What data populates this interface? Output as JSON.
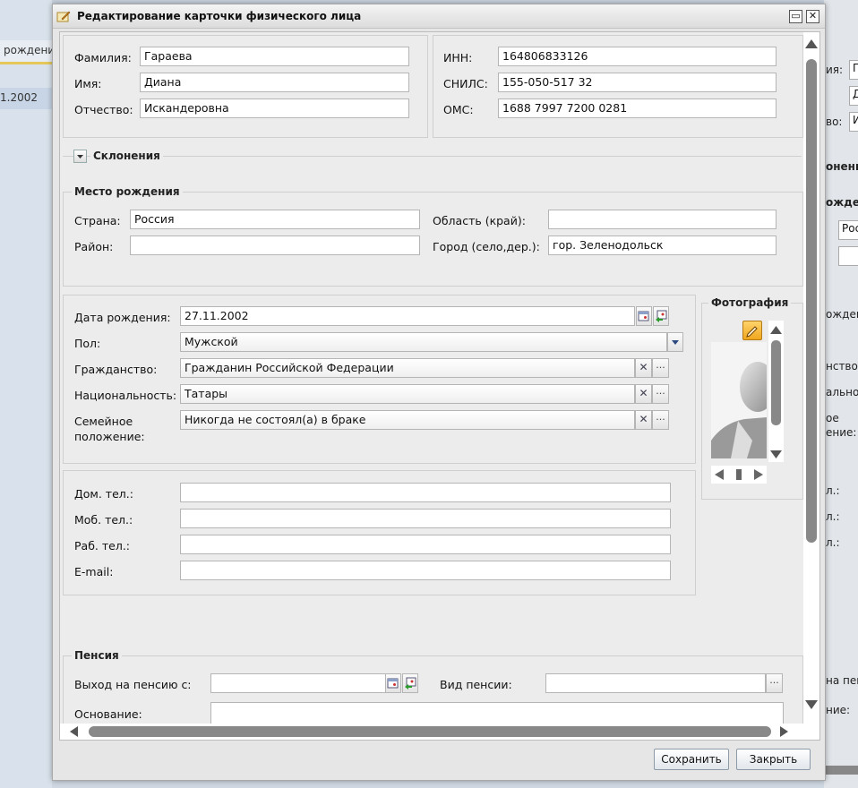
{
  "background": {
    "left_row1": "рождения",
    "left_row2": "1.2002",
    "right_labels": [
      "ия:",
      "во:",
      "онени",
      "ожде",
      "Рос",
      "ожден",
      "нство:",
      "ально",
      "ое",
      "ение:",
      "л.:",
      "л.:",
      "л.:",
      "на пен",
      "ние:"
    ],
    "right_field_texts": [
      "Г",
      "Д",
      "И"
    ]
  },
  "window": {
    "title": "Редактирование карточки физического лица",
    "maximize_glyph": "▭",
    "close_glyph": "✕"
  },
  "name_section": {
    "surname_label": "Фамилия:",
    "surname_value": "Гараева",
    "name_label": "Имя:",
    "name_value": "Диана",
    "patronymic_label": "Отчество:",
    "patronymic_value": "Искандеровна"
  },
  "ids_section": {
    "inn_label": "ИНН:",
    "inn_value": "164806833126",
    "snils_label": "СНИЛС:",
    "snils_value": "155-050-517 32",
    "oms_label": "ОМС:",
    "oms_value": "1688 7997 7200 0281"
  },
  "declension": {
    "label": "Склонения"
  },
  "birthplace": {
    "legend": "Место рождения",
    "country_label": "Страна:",
    "country_value": "Россия",
    "region_label": "Область (край):",
    "region_value": "",
    "district_label": "Район:",
    "district_value": "",
    "city_label": "Город (село,дер.):",
    "city_value": "гор. Зеленодольск"
  },
  "personal": {
    "birthdate_label": "Дата рождения:",
    "birthdate_value": "27.11.2002",
    "gender_label": "Пол:",
    "gender_value": "Мужской",
    "citizenship_label": "Гражданство:",
    "citizenship_value": "Гражданин Российской Федерации",
    "nationality_label": "Национальность:",
    "nationality_value": "Татары",
    "marital_label_1": "Семейное",
    "marital_label_2": "положение:",
    "marital_value": "Никогда не состоял(а) в браке",
    "clear_glyph": "✕",
    "more_glyph": "···"
  },
  "contacts": {
    "home_label": "Дом. тел.:",
    "home_value": "",
    "mobile_label": "Моб. тел.:",
    "mobile_value": "",
    "work_label": "Раб. тел.:",
    "work_value": "",
    "email_label": "E-mail:",
    "email_value": ""
  },
  "photo": {
    "legend": "Фотография"
  },
  "pension": {
    "legend": "Пенсия",
    "start_label": "Выход на пенсию с:",
    "start_value": "",
    "type_label": "Вид пенсии:",
    "type_value": "",
    "basis_label": "Основание:",
    "more_glyph": "···"
  },
  "buttons": {
    "save": "Сохранить",
    "close": "Закрыть"
  }
}
